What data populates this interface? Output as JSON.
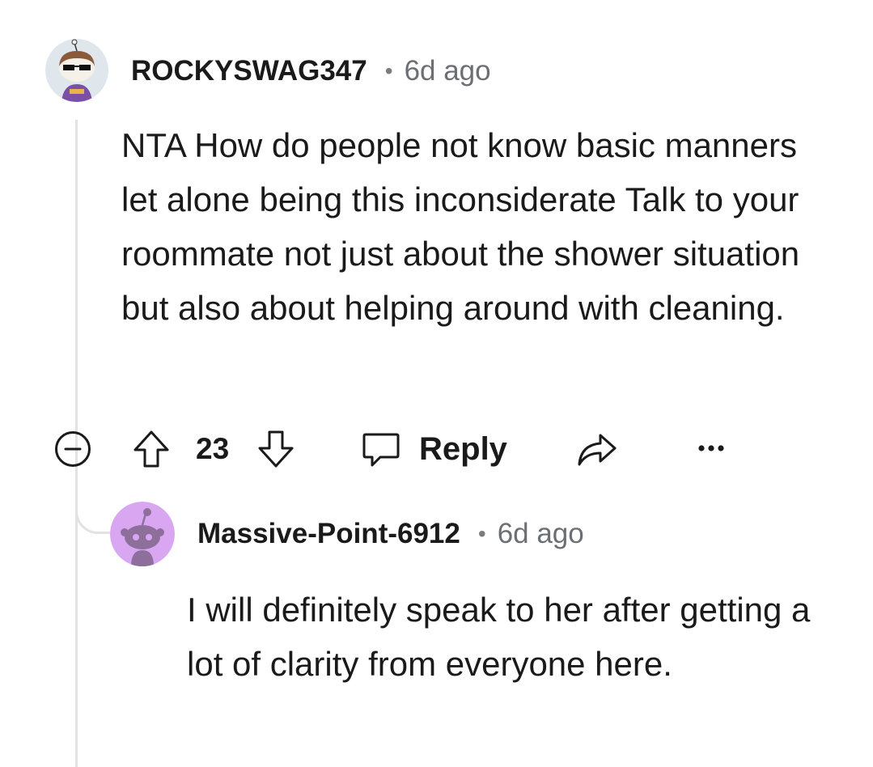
{
  "comments": [
    {
      "username": "ROCKYSWAG347",
      "age": "6d ago",
      "body": "NTA How do people not know basic manners let alone being this inconsiderate Talk to your roommate not just about the shower situation but also about helping around with cleaning.",
      "avatar": "snoo-avatar-sunglasses",
      "actions": {
        "score": "23",
        "reply_label": "Reply"
      }
    },
    {
      "username": "Massive-Point-6912",
      "age": "6d ago",
      "body": "I will definitely speak to her after getting a lot of clarity from everyone here.",
      "avatar": "snoo-avatar-default"
    }
  ],
  "colors": {
    "text": "#1a1a1b",
    "meta_text": "#6b6f74",
    "thread_line": "#e2e2e2",
    "avatar2_bg": "#d9a6f1",
    "avatar2_snoo": "#8e6f9c"
  }
}
